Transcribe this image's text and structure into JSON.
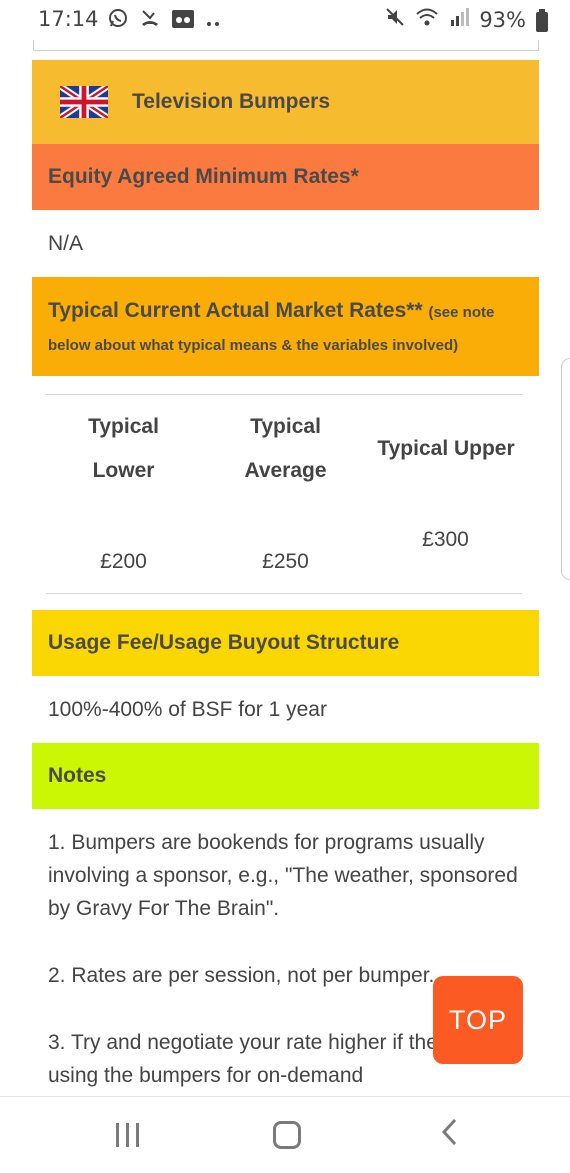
{
  "status_bar": {
    "time": "17:14",
    "battery": "93%",
    "left_icons": [
      "whatsapp-icon",
      "missed-call-icon",
      "voicemail-icon",
      "more-dots-icon"
    ],
    "right_icons": [
      "mute-icon",
      "wifi-icon",
      "signal-icon",
      "battery-icon"
    ]
  },
  "title_band": {
    "title": "Television Bumpers",
    "flag": "uk-flag-icon",
    "color": "#f7bb2f"
  },
  "equity": {
    "heading": "Equity Agreed Minimum Rates*",
    "value": "N/A",
    "color": "#fb7a40"
  },
  "typical": {
    "heading": "Typical Current Actual Market Rates**",
    "note_inline": "(see note",
    "note_line2": "below about what typical means & the variables involved)",
    "color": "#f9ad06",
    "columns": [
      {
        "line1": "Typical",
        "line2": "Lower",
        "value": "£200"
      },
      {
        "line1": "Typical",
        "line2": "Average",
        "value": "£250"
      },
      {
        "line1": "Typical Upper",
        "line2": "",
        "value": "£300"
      }
    ]
  },
  "usage": {
    "heading": "Usage Fee/Usage Buyout Structure",
    "value": "100%-400% of BSF for 1 year",
    "color": "#fad703"
  },
  "notes": {
    "heading": "Notes",
    "color": "#cbf704",
    "items": [
      "1. Bumpers are bookends for programs usually involving a sponsor, e.g., \"The weather, sponsored by Gravy For The Brain\".",
      "2. Rates are per session, not per bumper.",
      "3. Try and negotiate your rate higher if they're also using the bumpers for on-demand"
    ]
  },
  "top_button": {
    "label": "TOP",
    "color": "#fb5a22"
  },
  "nav": {
    "icons": [
      "recent-apps-icon",
      "home-icon",
      "back-icon"
    ]
  }
}
